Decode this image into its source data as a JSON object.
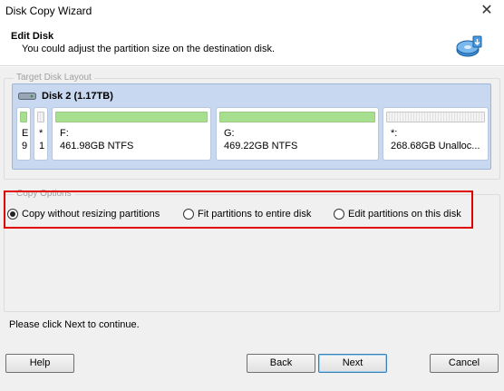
{
  "window": {
    "title": "Disk Copy Wizard",
    "close_glyph": "✕"
  },
  "header": {
    "title": "Edit Disk",
    "subtitle": "You could adjust the partition size on the destination disk.",
    "icon": "disk-copy-icon"
  },
  "target_layout": {
    "label": "Target Disk Layout",
    "disk": {
      "name": "Disk 2 (1.17TB)",
      "icon": "hard-disk-icon",
      "partitions": [
        {
          "letter": "E",
          "info": "9",
          "type": "used"
        },
        {
          "letter": "*",
          "info": "1",
          "type": "used-empty"
        },
        {
          "letter": "F:",
          "info": "461.98GB NTFS",
          "type": "used"
        },
        {
          "letter": "G:",
          "info": "469.22GB NTFS",
          "type": "used"
        },
        {
          "letter": "*:",
          "info": "268.68GB Unalloc...",
          "type": "free"
        }
      ]
    }
  },
  "copy_options": {
    "label": "Copy Options",
    "options": [
      {
        "label": "Copy without resizing partitions",
        "selected": true
      },
      {
        "label": "Fit partitions to entire disk",
        "selected": false
      },
      {
        "label": "Edit partitions on this disk",
        "selected": false
      }
    ],
    "highlight_color": "#e00000"
  },
  "hint": "Please click Next to continue.",
  "buttons": {
    "help": "Help",
    "back": "Back",
    "next": "Next",
    "cancel": "Cancel"
  }
}
